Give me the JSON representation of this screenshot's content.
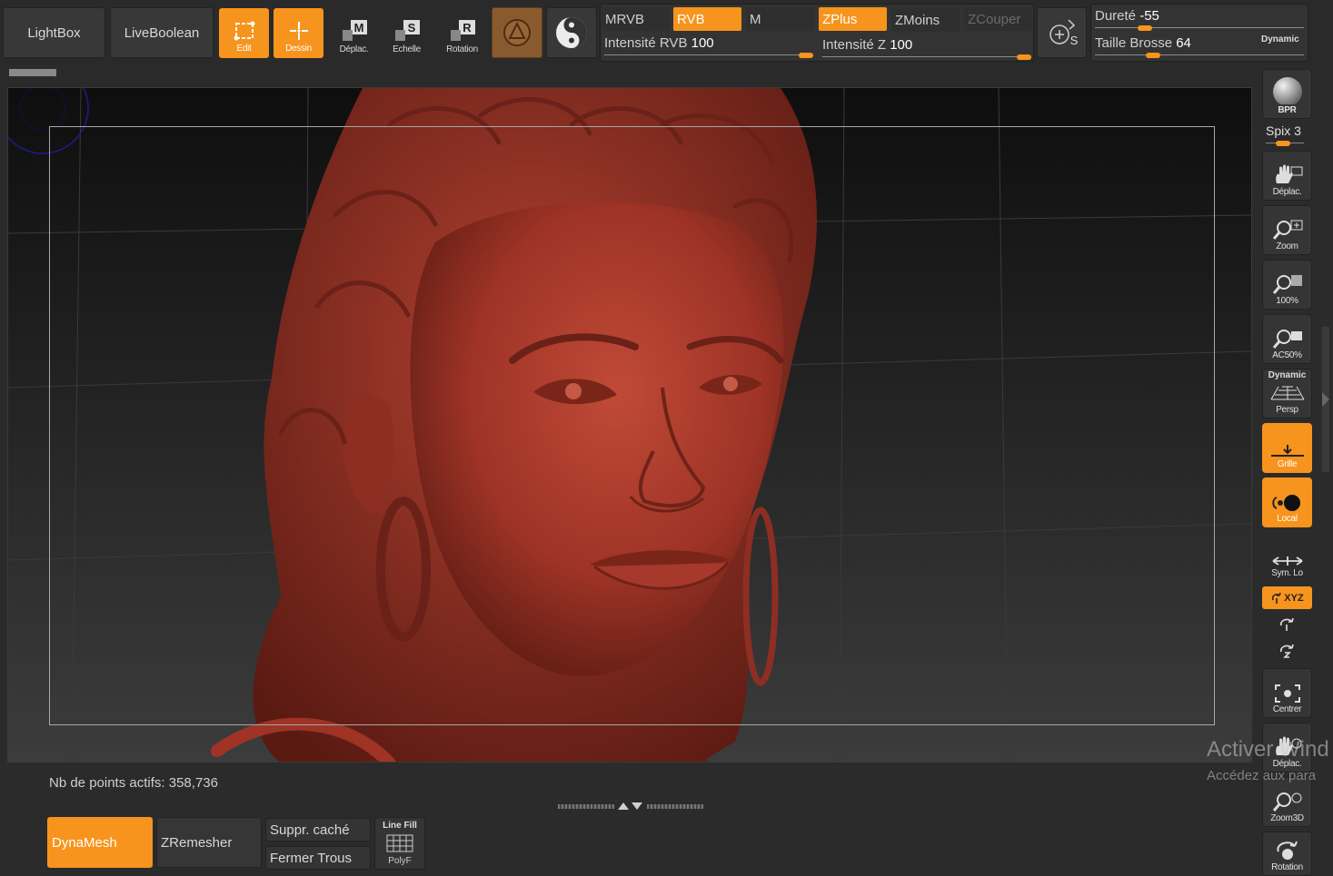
{
  "toolbar": {
    "lightbox": "LightBox",
    "liveboolean": "LiveBoolean",
    "edit": "Edit",
    "draw": "Dessin",
    "move": "Déplac.",
    "scale": "Echelle",
    "rotate": "Rotation",
    "move_letter": "M",
    "scale_letter": "S",
    "rotate_letter": "R",
    "mrvb": "MRVB",
    "rvb": "RVB",
    "m": "M",
    "zplus": "ZPlus",
    "zmoins": "ZMoins",
    "zcouper": "ZCouper",
    "rvb_intensity_label": "Intensité RVB",
    "rvb_intensity_value": "100",
    "z_intensity_label": "Intensité Z",
    "z_intensity_value": "100",
    "hardness_label": "Dureté",
    "hardness_value": "-55",
    "brush_size_label": "Taille Brosse",
    "brush_size_value": "64",
    "dynamic": "Dynamic",
    "s_letter": "S",
    "rvb_intensity_fraction": 1.0,
    "z_intensity_fraction": 1.0,
    "hardness_fraction": 0.22,
    "brush_size_fraction": 0.26
  },
  "right_shelf": {
    "bpr": "BPR",
    "spix_label": "Spix",
    "spix_value": "3",
    "move": "Déplac.",
    "zoom": "Zoom",
    "actual": "100%",
    "ac50": "AC50%",
    "persp_top": "Dynamic",
    "persp": "Persp",
    "grid": "Grille",
    "local": "Local",
    "sym": "Sym. Lo",
    "xyz": "XYZ",
    "center": "Centrer",
    "move2": "Déplac.",
    "zoom3d": "Zoom3D",
    "rotation": "Rotation"
  },
  "status": {
    "active_points_label": "Nb de points actifs:",
    "active_points_value": "358,736"
  },
  "bottom": {
    "dynamesh": "DynaMesh",
    "zremesher": "ZRemesher",
    "del_hidden": "Suppr. caché",
    "close_holes": "Fermer Trous",
    "linefill_top": "Line Fill",
    "linefill_bottom": "PolyF"
  },
  "watermark": {
    "line1": "Activer Wind",
    "line2": "Accédez aux para"
  },
  "colors": {
    "accent": "#f7941d",
    "clay": "#a8392c",
    "bg": "#2b2b2b"
  }
}
